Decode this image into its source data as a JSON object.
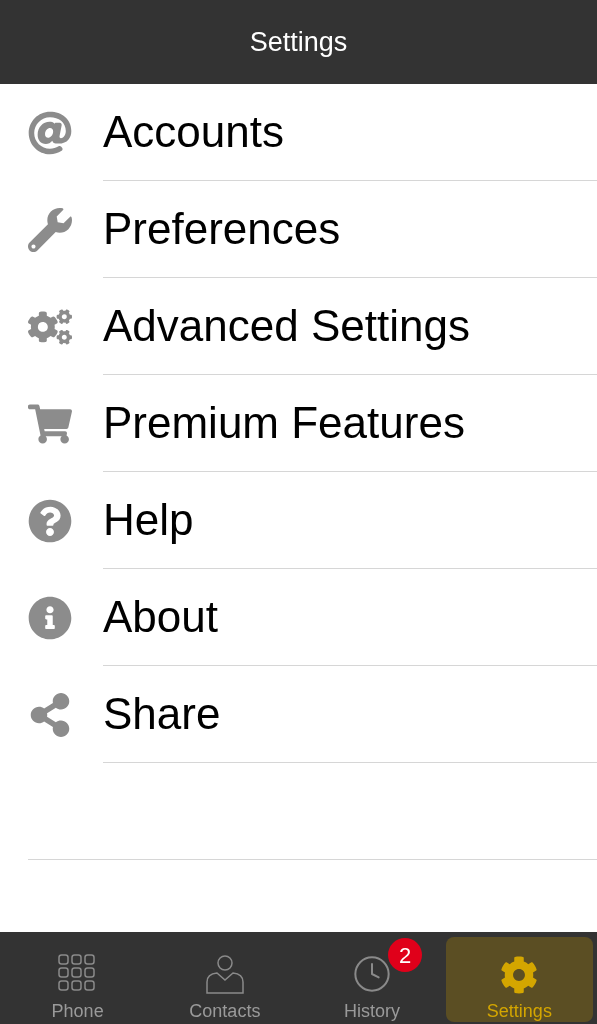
{
  "header": {
    "title": "Settings"
  },
  "menu": [
    {
      "label": "Accounts"
    },
    {
      "label": "Preferences"
    },
    {
      "label": "Advanced Settings"
    },
    {
      "label": "Premium Features"
    },
    {
      "label": "Help"
    },
    {
      "label": "About"
    },
    {
      "label": "Share"
    }
  ],
  "tab_bar": [
    {
      "label": "Phone",
      "selected": false
    },
    {
      "label": "Contacts",
      "selected": false
    },
    {
      "label": "History",
      "selected": false,
      "badge": "2"
    },
    {
      "label": "Settings",
      "selected": true
    }
  ]
}
